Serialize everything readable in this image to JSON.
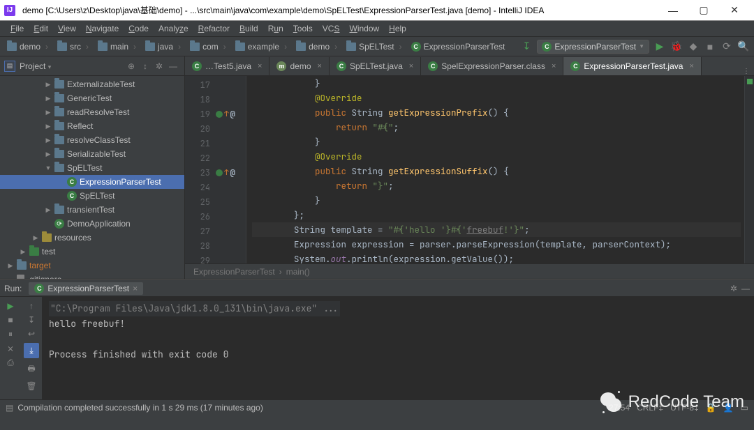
{
  "title": "demo [C:\\Users\\z\\Desktop\\java\\基础\\demo] - ...\\src\\main\\java\\com\\example\\demo\\SpELTest\\ExpressionParserTest.java [demo] - IntelliJ IDEA",
  "menu": {
    "file": "File",
    "edit": "Edit",
    "view": "View",
    "navigate": "Navigate",
    "code": "Code",
    "analyze": "Analyze",
    "refactor": "Refactor",
    "build": "Build",
    "run": "Run",
    "tools": "Tools",
    "vcs": "VCS",
    "window": "Window",
    "help": "Help"
  },
  "breadcrumbs": [
    "demo",
    "src",
    "main",
    "java",
    "com",
    "example",
    "demo",
    "SpELTest",
    "ExpressionParserTest"
  ],
  "run_config": {
    "name": "ExpressionParserTest"
  },
  "project_tool": {
    "title": "Project",
    "dropdown": "▾"
  },
  "tree": [
    {
      "indent": 3,
      "twisty": "▶",
      "icon": "folder",
      "label": "ExternalizableTest"
    },
    {
      "indent": 3,
      "twisty": "▶",
      "icon": "folder",
      "label": "GenericTest"
    },
    {
      "indent": 3,
      "twisty": "▶",
      "icon": "folder",
      "label": "readResolveTest"
    },
    {
      "indent": 3,
      "twisty": "▶",
      "icon": "folder",
      "label": "Reflect"
    },
    {
      "indent": 3,
      "twisty": "▶",
      "icon": "folder",
      "label": "resolveClassTest"
    },
    {
      "indent": 3,
      "twisty": "▶",
      "icon": "folder",
      "label": "SerializableTest"
    },
    {
      "indent": 3,
      "twisty": "▼",
      "icon": "folder",
      "label": "SpELTest"
    },
    {
      "indent": 4,
      "twisty": "",
      "icon": "class",
      "label": "ExpressionParserTest",
      "selected": true
    },
    {
      "indent": 4,
      "twisty": "",
      "icon": "class",
      "label": "SpELTest"
    },
    {
      "indent": 3,
      "twisty": "▶",
      "icon": "folder",
      "label": "transientTest"
    },
    {
      "indent": 3,
      "twisty": "",
      "icon": "app",
      "label": "DemoApplication"
    },
    {
      "indent": 2,
      "twisty": "▶",
      "icon": "res",
      "label": "resources"
    },
    {
      "indent": 1,
      "twisty": "▶",
      "icon": "test",
      "label": "test"
    },
    {
      "indent": 0,
      "twisty": "▶",
      "icon": "folder",
      "label": "target",
      "orange": true
    },
    {
      "indent": 0,
      "twisty": "",
      "icon": "file",
      "label": ".gitignore"
    }
  ],
  "tabs": [
    {
      "icon": "class",
      "label": "Test5.java",
      "trunc": true
    },
    {
      "icon": "m",
      "label": "demo"
    },
    {
      "icon": "class",
      "label": "SpELTest.java"
    },
    {
      "icon": "class",
      "label": "SpelExpressionParser.class"
    },
    {
      "icon": "class",
      "label": "ExpressionParserTest.java",
      "active": true
    }
  ],
  "gutter": {
    "start": 17,
    "end": 29,
    "lines": [
      {
        "n": 17
      },
      {
        "n": 18
      },
      {
        "n": 19,
        "circle": true,
        "arrow": true,
        "at": true
      },
      {
        "n": 20
      },
      {
        "n": 21
      },
      {
        "n": 22
      },
      {
        "n": 23,
        "circle": true,
        "arrow": true,
        "at": true
      },
      {
        "n": 24
      },
      {
        "n": 25
      },
      {
        "n": 26
      },
      {
        "n": 27,
        "current": true
      },
      {
        "n": 28
      },
      {
        "n": 29
      }
    ]
  },
  "code_lines": [
    {
      "html": "            }"
    },
    {
      "html": "            <span class='an'>@Override</span>"
    },
    {
      "html": "            <span class='kw'>public</span> String <span class='mth'>getExpressionPrefix</span>() {"
    },
    {
      "html": "                <span class='kw'>return</span> <span class='str'>\"#{\"</span>;"
    },
    {
      "html": "            }"
    },
    {
      "html": "            <span class='an'>@Override</span>"
    },
    {
      "html": "            <span class='kw'>public</span> String <span class='mth'>getExpressionSuffix</span>() {"
    },
    {
      "html": "                <span class='kw'>return</span> <span class='str'>\"}\"</span>;"
    },
    {
      "html": "            }"
    },
    {
      "html": "        };"
    },
    {
      "html": "        String template = <span class='str'>\"#{'hello '}#{'</span><span class='todo'>freebuf</span><span class='str'>!'}\"</span>;",
      "current": true
    },
    {
      "html": "        Expression expression = parser.parseExpression(template, parserContext);"
    },
    {
      "html": "        System.<span class='fld'>out</span>.println(expression.getValue());"
    }
  ],
  "editor_crumbs": [
    "ExpressionParserTest",
    "main()"
  ],
  "run_panel": {
    "label": "Run:",
    "tab": "ExpressionParserTest",
    "cmd": "\"C:\\Program Files\\Java\\jdk1.8.0_131\\bin\\java.exe\" ...",
    "out1": "hello freebuf!",
    "out2": "",
    "out3": "Process finished with exit code 0"
  },
  "status": {
    "msg": "Compilation completed successfully in 1 s 29 ms (17 minutes ago)",
    "pos": "27:54",
    "sep": "CRLF‡",
    "enc": "UTF-8‡"
  },
  "watermark": "RedCode Team"
}
